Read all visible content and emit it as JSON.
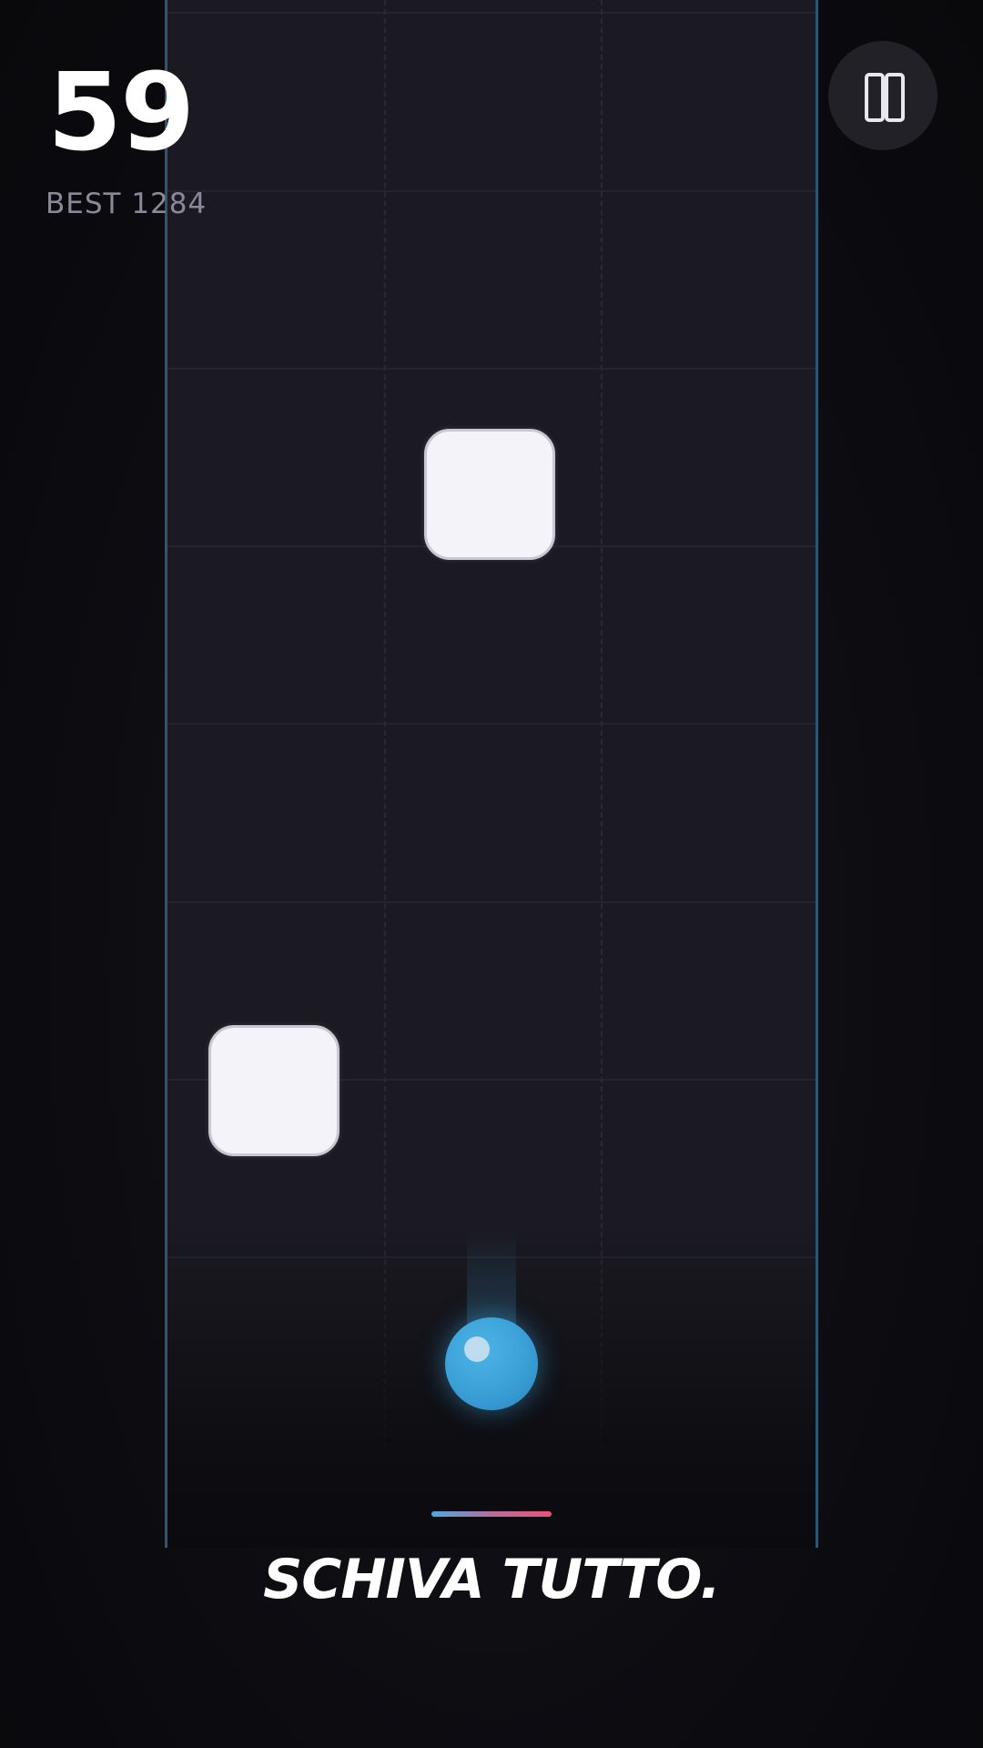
{
  "hud": {
    "score": "59",
    "best_label": "BEST 1284"
  },
  "controls": {
    "pause_icon": "pause-icon"
  },
  "tagline": "SCHIVA TUTTO.",
  "colors": {
    "background": "#0b0b0f",
    "track": "#1b1a22",
    "track_border": "#2f5670",
    "block": "#f4f3f9",
    "player": "#3a9fd6",
    "accent_start": "#4ba9e0",
    "accent_end": "#ef4f7a",
    "best_text": "#8a8899"
  },
  "game": {
    "lanes": 3,
    "obstacles": [
      {
        "lane": 2
      },
      {
        "lane": 1
      }
    ],
    "player_lane": 2
  }
}
